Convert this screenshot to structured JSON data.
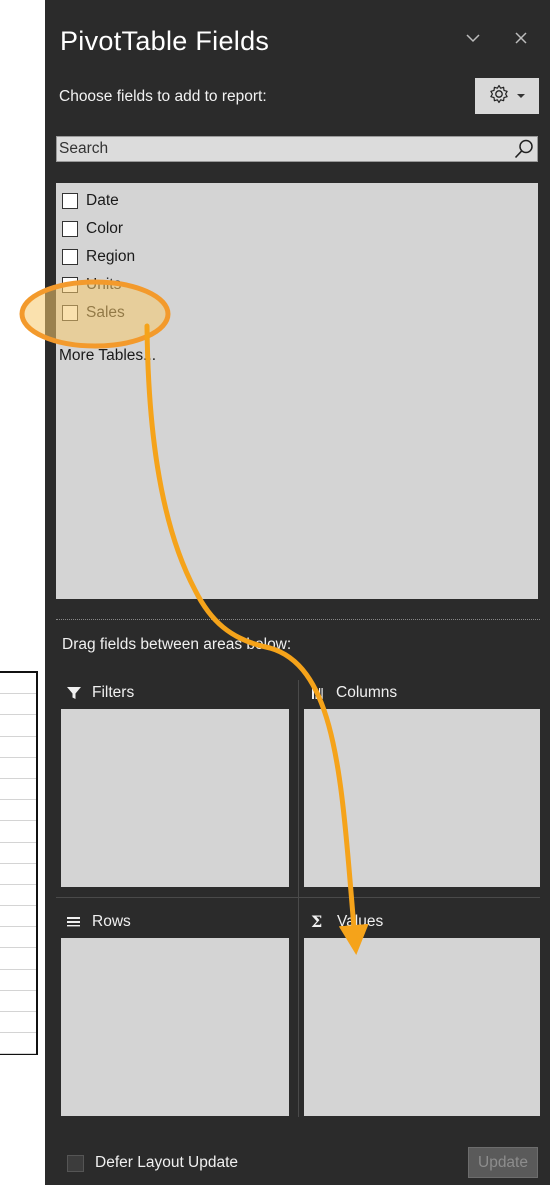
{
  "panel": {
    "title": "PivotTable Fields",
    "subtitle": "Choose fields to add to report:",
    "gear_icon": "gear-icon",
    "search": {
      "placeholder": "Search",
      "value": ""
    },
    "fields": [
      {
        "label": "Date",
        "checked": false
      },
      {
        "label": "Color",
        "checked": false
      },
      {
        "label": "Region",
        "checked": false
      },
      {
        "label": "Units",
        "checked": false
      },
      {
        "label": "Sales",
        "checked": false
      }
    ],
    "more_tables": "More Tables...",
    "drag_label": "Drag fields between areas below:",
    "areas": {
      "filters": "Filters",
      "columns": "Columns",
      "rows": "Rows",
      "values": "Values"
    },
    "defer_label": "Defer Layout Update",
    "update_label": "Update"
  },
  "annotation": {
    "highlight_color": "#f39a2c",
    "highlight_fill": "#f6c96b",
    "arrow_color": "#f5a31a"
  },
  "colors": {
    "panel_bg": "#2b2b2b",
    "box_bg": "#d4d4d4"
  }
}
